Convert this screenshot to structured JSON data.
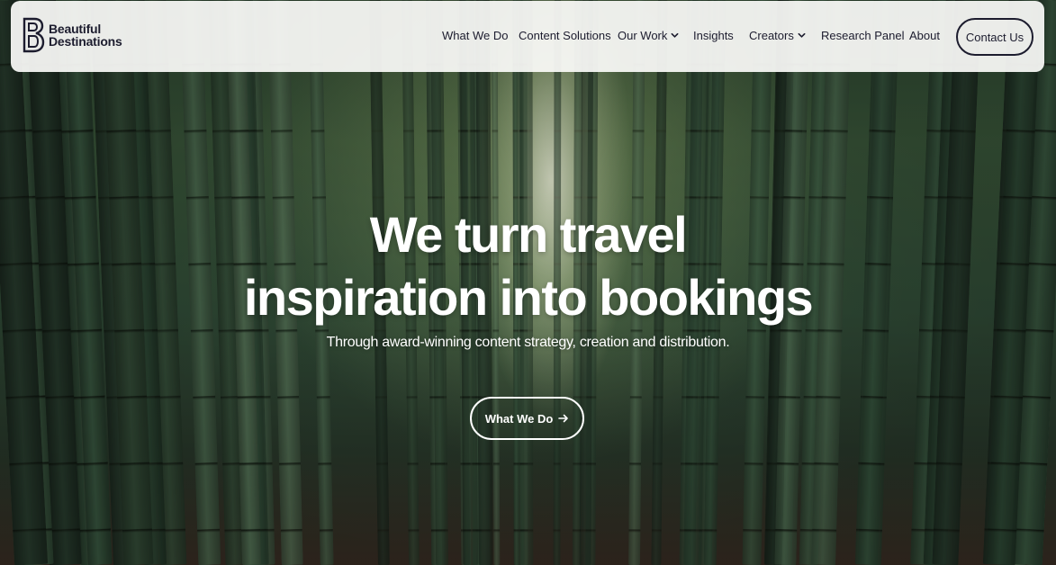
{
  "brand": {
    "name_line1": "Beautiful",
    "name_line2": "Destinations",
    "logo_icon": "b-monogram-icon"
  },
  "nav": {
    "items": [
      {
        "label": "What We Do",
        "has_dropdown": false
      },
      {
        "label": "Content Solutions",
        "has_dropdown": false
      },
      {
        "label": "Our Work",
        "has_dropdown": true
      },
      {
        "label": "Insights",
        "has_dropdown": false
      },
      {
        "label": "Creators",
        "has_dropdown": true
      },
      {
        "label": "Research Panel",
        "has_dropdown": false
      },
      {
        "label": "About",
        "has_dropdown": false
      }
    ],
    "contact_label": "Contact Us"
  },
  "hero": {
    "headline_line1": "We turn travel",
    "headline_line2": "inspiration into bookings",
    "subtitle": "Through award-winning content strategy, creation and distribution.",
    "cta_label": "What We Do",
    "cta_icon": "arrow-right-icon",
    "background": "bamboo-forest-photo"
  },
  "colors": {
    "navbar_bg": "#fcfcfa",
    "text_dark": "#1c1c2e",
    "hero_text": "#ffffff"
  }
}
